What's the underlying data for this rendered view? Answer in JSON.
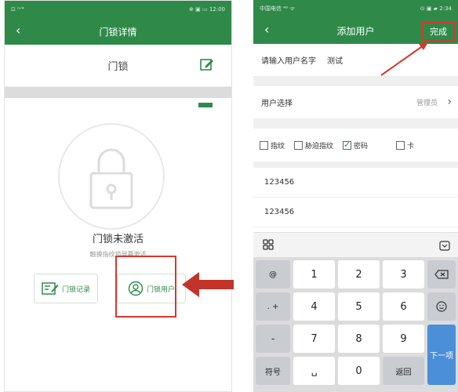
{
  "left_screen": {
    "status": {
      "left_icons": "⊡ ⁰ᐟ⁴",
      "right": "⊗ ▣ ▭ 12:00"
    },
    "title": "门锁详情",
    "lock_name": "门锁",
    "lock_status": "门锁未激活",
    "lock_hint": "触摸指纹锁屏幕激活",
    "buttons": {
      "record": "门锁记录",
      "users": "门锁用户"
    }
  },
  "right_screen": {
    "status": {
      "left": "中国电信 ⁴ᴳ ᯤ",
      "right": "⊙ ▣ ▰ 2:34"
    },
    "title": "添加用户",
    "done_label": "完成",
    "name_label": "请输入用户名字",
    "name_value": "测试",
    "user_select_label": "用户选择",
    "user_select_value": "管理员",
    "checkboxes": [
      {
        "label": "指纹",
        "checked": false
      },
      {
        "label": "胁迫指纹",
        "checked": false
      },
      {
        "label": "密码",
        "checked": true
      },
      {
        "label": "卡",
        "checked": false
      }
    ],
    "password": "123456",
    "password_confirm": "123456"
  },
  "keyboard": {
    "left_col": [
      "@",
      ". +",
      "-",
      "符号"
    ],
    "digits": [
      "1",
      "2",
      "3",
      "4",
      "5",
      "6",
      "7",
      "8",
      "9",
      "0"
    ],
    "enter": "返回",
    "next": "下一项",
    "space": "␣"
  },
  "colors": {
    "brand_green": "#2f8a4a",
    "highlight_red": "#d6382c",
    "next_blue": "#4a8fd8"
  }
}
